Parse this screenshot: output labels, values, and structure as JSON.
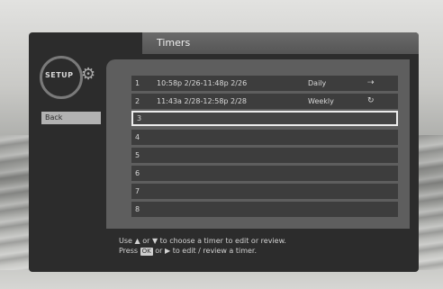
{
  "header": {
    "title": "Timers"
  },
  "sidebar": {
    "logo_text": "SETUP",
    "logo_icon": "gear-icon",
    "back_label": "Back"
  },
  "timers": [
    {
      "num": "1",
      "time": "10:58p 2/26-11:48p 2/26",
      "freq": "Daily",
      "icon": "repeat-icon",
      "icon_glyph": "⇢"
    },
    {
      "num": "2",
      "time": "11:43a 2/28-12:58p 2/28",
      "freq": "Weekly",
      "icon": "cycle-icon",
      "icon_glyph": "↻"
    },
    {
      "num": "3",
      "time": "",
      "freq": "",
      "icon": "",
      "icon_glyph": ""
    },
    {
      "num": "4",
      "time": "",
      "freq": "",
      "icon": "",
      "icon_glyph": ""
    },
    {
      "num": "5",
      "time": "",
      "freq": "",
      "icon": "",
      "icon_glyph": ""
    },
    {
      "num": "6",
      "time": "",
      "freq": "",
      "icon": "",
      "icon_glyph": ""
    },
    {
      "num": "7",
      "time": "",
      "freq": "",
      "icon": "",
      "icon_glyph": ""
    },
    {
      "num": "8",
      "time": "",
      "freq": "",
      "icon": "",
      "icon_glyph": ""
    }
  ],
  "footer": {
    "line1_pre": "Use ",
    "line1_up": "▲",
    "line1_mid": " or ",
    "line1_down": "▼",
    "line1_post": " to choose a timer to edit or review.",
    "line2_pre": "Press ",
    "line2_ok": "OK",
    "line2_mid": " or ",
    "line2_arrow": "▶",
    "line2_post": " to edit / review a timer."
  }
}
